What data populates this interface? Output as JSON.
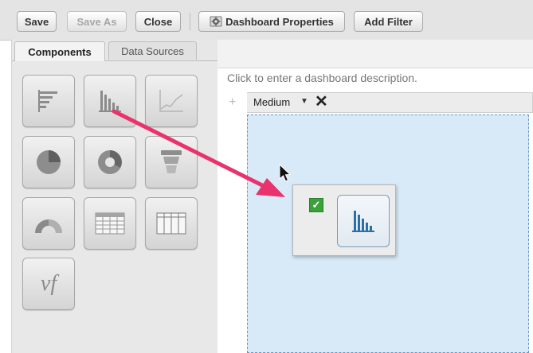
{
  "toolbar": {
    "save_label": "Save",
    "save_as_label": "Save As",
    "close_label": "Close",
    "dashboard_properties_label": "Dashboard Properties",
    "add_filter_label": "Add Filter"
  },
  "left_panel": {
    "tabs": [
      {
        "label": "Components",
        "active": true
      },
      {
        "label": "Data Sources",
        "active": false
      }
    ],
    "components": [
      {
        "icon": "horizontal-bar-chart-icon"
      },
      {
        "icon": "vertical-bar-chart-icon"
      },
      {
        "icon": "line-chart-icon"
      },
      {
        "icon": "pie-chart-icon"
      },
      {
        "icon": "donut-chart-icon"
      },
      {
        "icon": "funnel-chart-icon"
      },
      {
        "icon": "gauge-icon"
      },
      {
        "icon": "table-icon"
      },
      {
        "icon": "metric-table-icon"
      },
      {
        "icon": "visualforce-icon",
        "symbol": "vf"
      }
    ]
  },
  "dashboard": {
    "description_placeholder": "Click to enter a dashboard description.",
    "column_size": "Medium",
    "dragged_component": {
      "icon": "vertical-bar-chart-icon",
      "checked": true
    }
  },
  "colors": {
    "arrow": "#e8336d",
    "column_bg": "#d8eaf8",
    "chart_blue": "#2a6fa8"
  }
}
